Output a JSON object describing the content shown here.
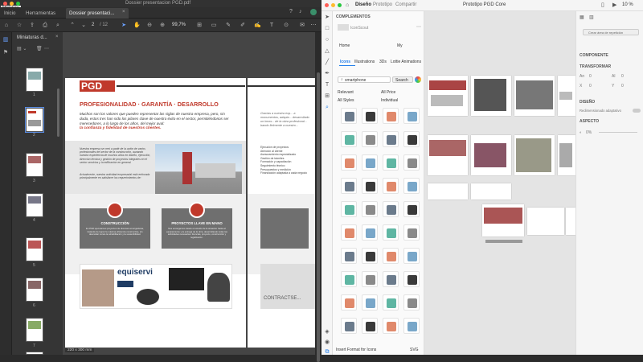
{
  "pdf_viewer": {
    "window_title": "Dossier presentacion PGD.pdf",
    "tooltip": "Miniatura",
    "tabs": [
      {
        "label": "Inicio"
      },
      {
        "label": "Herramientas"
      },
      {
        "label": "Dossier presentaci..."
      }
    ],
    "page_current": "2",
    "page_total": "/ 12",
    "zoom": "99,7%",
    "thumbs_title": "Miniaturas d...",
    "thumb_numbers": [
      "1",
      "2",
      "3",
      "4",
      "5",
      "6",
      "7",
      "8"
    ],
    "page_size": "220 x 300 mm",
    "document": {
      "logo_text": "PGD",
      "headline": "PROFESIONALIDAD · GARANTÍA · DESARROLLO",
      "intro": "Muchos son los valores que pueden representar las siglas de nuestra empresa, pero, sin duda, estos tres han sido los pilares clave de nuestro éxito en el sector, permitiéndonos ser merecedores, a lo largo de los años, del mejor aval:",
      "intro_highlight": "la confianza y fidelidad de nuestros clientes.",
      "column_text": "Nuestra empresa se creó a partir de la unión de varios profesionales del sector de la construcción, aunando nuestra experiencia de muchos años en diseño, ejecución, dirección técnica y gestión de proyectos integrales en el sector servicios y la edificación en general.",
      "column_text2": "Actualmente, nuestra actividad empresarial está enfocada principalmente en satisfacer los requerimientos de:",
      "card1_title": "CONSTRUCCIÓN",
      "card1_text": "En PGD ejecutamos proyectos de diversas envergaduras, tratando de lograr la máxima eficiencia constructiva, sin descuidar nunca la rehabilitación y la sostenibilidad.",
      "card2_title": "PROYECTOS LLAVE EN MANO",
      "card2_text": "Nos encargamos desde el estudio de la situación hasta el equipamiento y la entrega de la obra, desarrollando todas las actividades necesarias: licencias, proyecto, construcción y legalización.",
      "ad_brand": "equiservi",
      "right_page_text": "Gracias a nuestra exp... a monumentos, adapta... desarrollado un know... de la obra profesional... bando fielmente a nuestro...",
      "right_page_list": [
        "Ejecución de proyectos",
        "Atención al cliente",
        "Asesoramiento especializado",
        "Gestión de trámites",
        "Formación y capacitación",
        "Seguimiento técnico",
        "Presupuestos y medición",
        "Financiación adaptada a cada negocio"
      ],
      "right_ad_text": "CONTRACTSE..."
    }
  },
  "xd": {
    "title": "Prototipo PGD Core",
    "tabs": [
      {
        "label": "Diseño"
      },
      {
        "label": "Prototipo"
      },
      {
        "label": "Compartir"
      }
    ],
    "zoom": "10 %",
    "panel_title": "COMPLEMENTOS",
    "plugin_name": "IconScout",
    "nav_home": "Home",
    "nav_my": "My",
    "categories": [
      {
        "label": "Icons"
      },
      {
        "label": "Illustrations"
      },
      {
        "label": "3Ds"
      },
      {
        "label": "Lottie Animations"
      }
    ],
    "search_value": "smartphone",
    "search_button": "Search",
    "filter_relevant": "Relevant",
    "filter_price": "All Price",
    "filter_styles": "All Styles",
    "filter_individual": "Individual",
    "footer_label": "Insert Format for Icons",
    "footer_value": "SVG",
    "props": {
      "create_component": "Crear área de repetición",
      "section_component": "COMPONENTE",
      "section_transform": "TRANSFORMAR",
      "w_label": "An",
      "w_value": "0",
      "h_label": "Al",
      "h_value": "0",
      "x_label": "X",
      "x_value": "0",
      "y_label": "Y",
      "y_value": "0",
      "section_layout": "DISEÑO",
      "layout_label": "Redimensionado adaptativo",
      "section_appearance": "ASPECTO",
      "opacity_value": "0%"
    }
  },
  "colors": {
    "pdf_bg": "#454545",
    "brand_red": "#c0392b",
    "xd_accent": "#2680eb",
    "mac_close": "#ff5f57",
    "mac_min": "#febc2e",
    "mac_max": "#28c840"
  }
}
